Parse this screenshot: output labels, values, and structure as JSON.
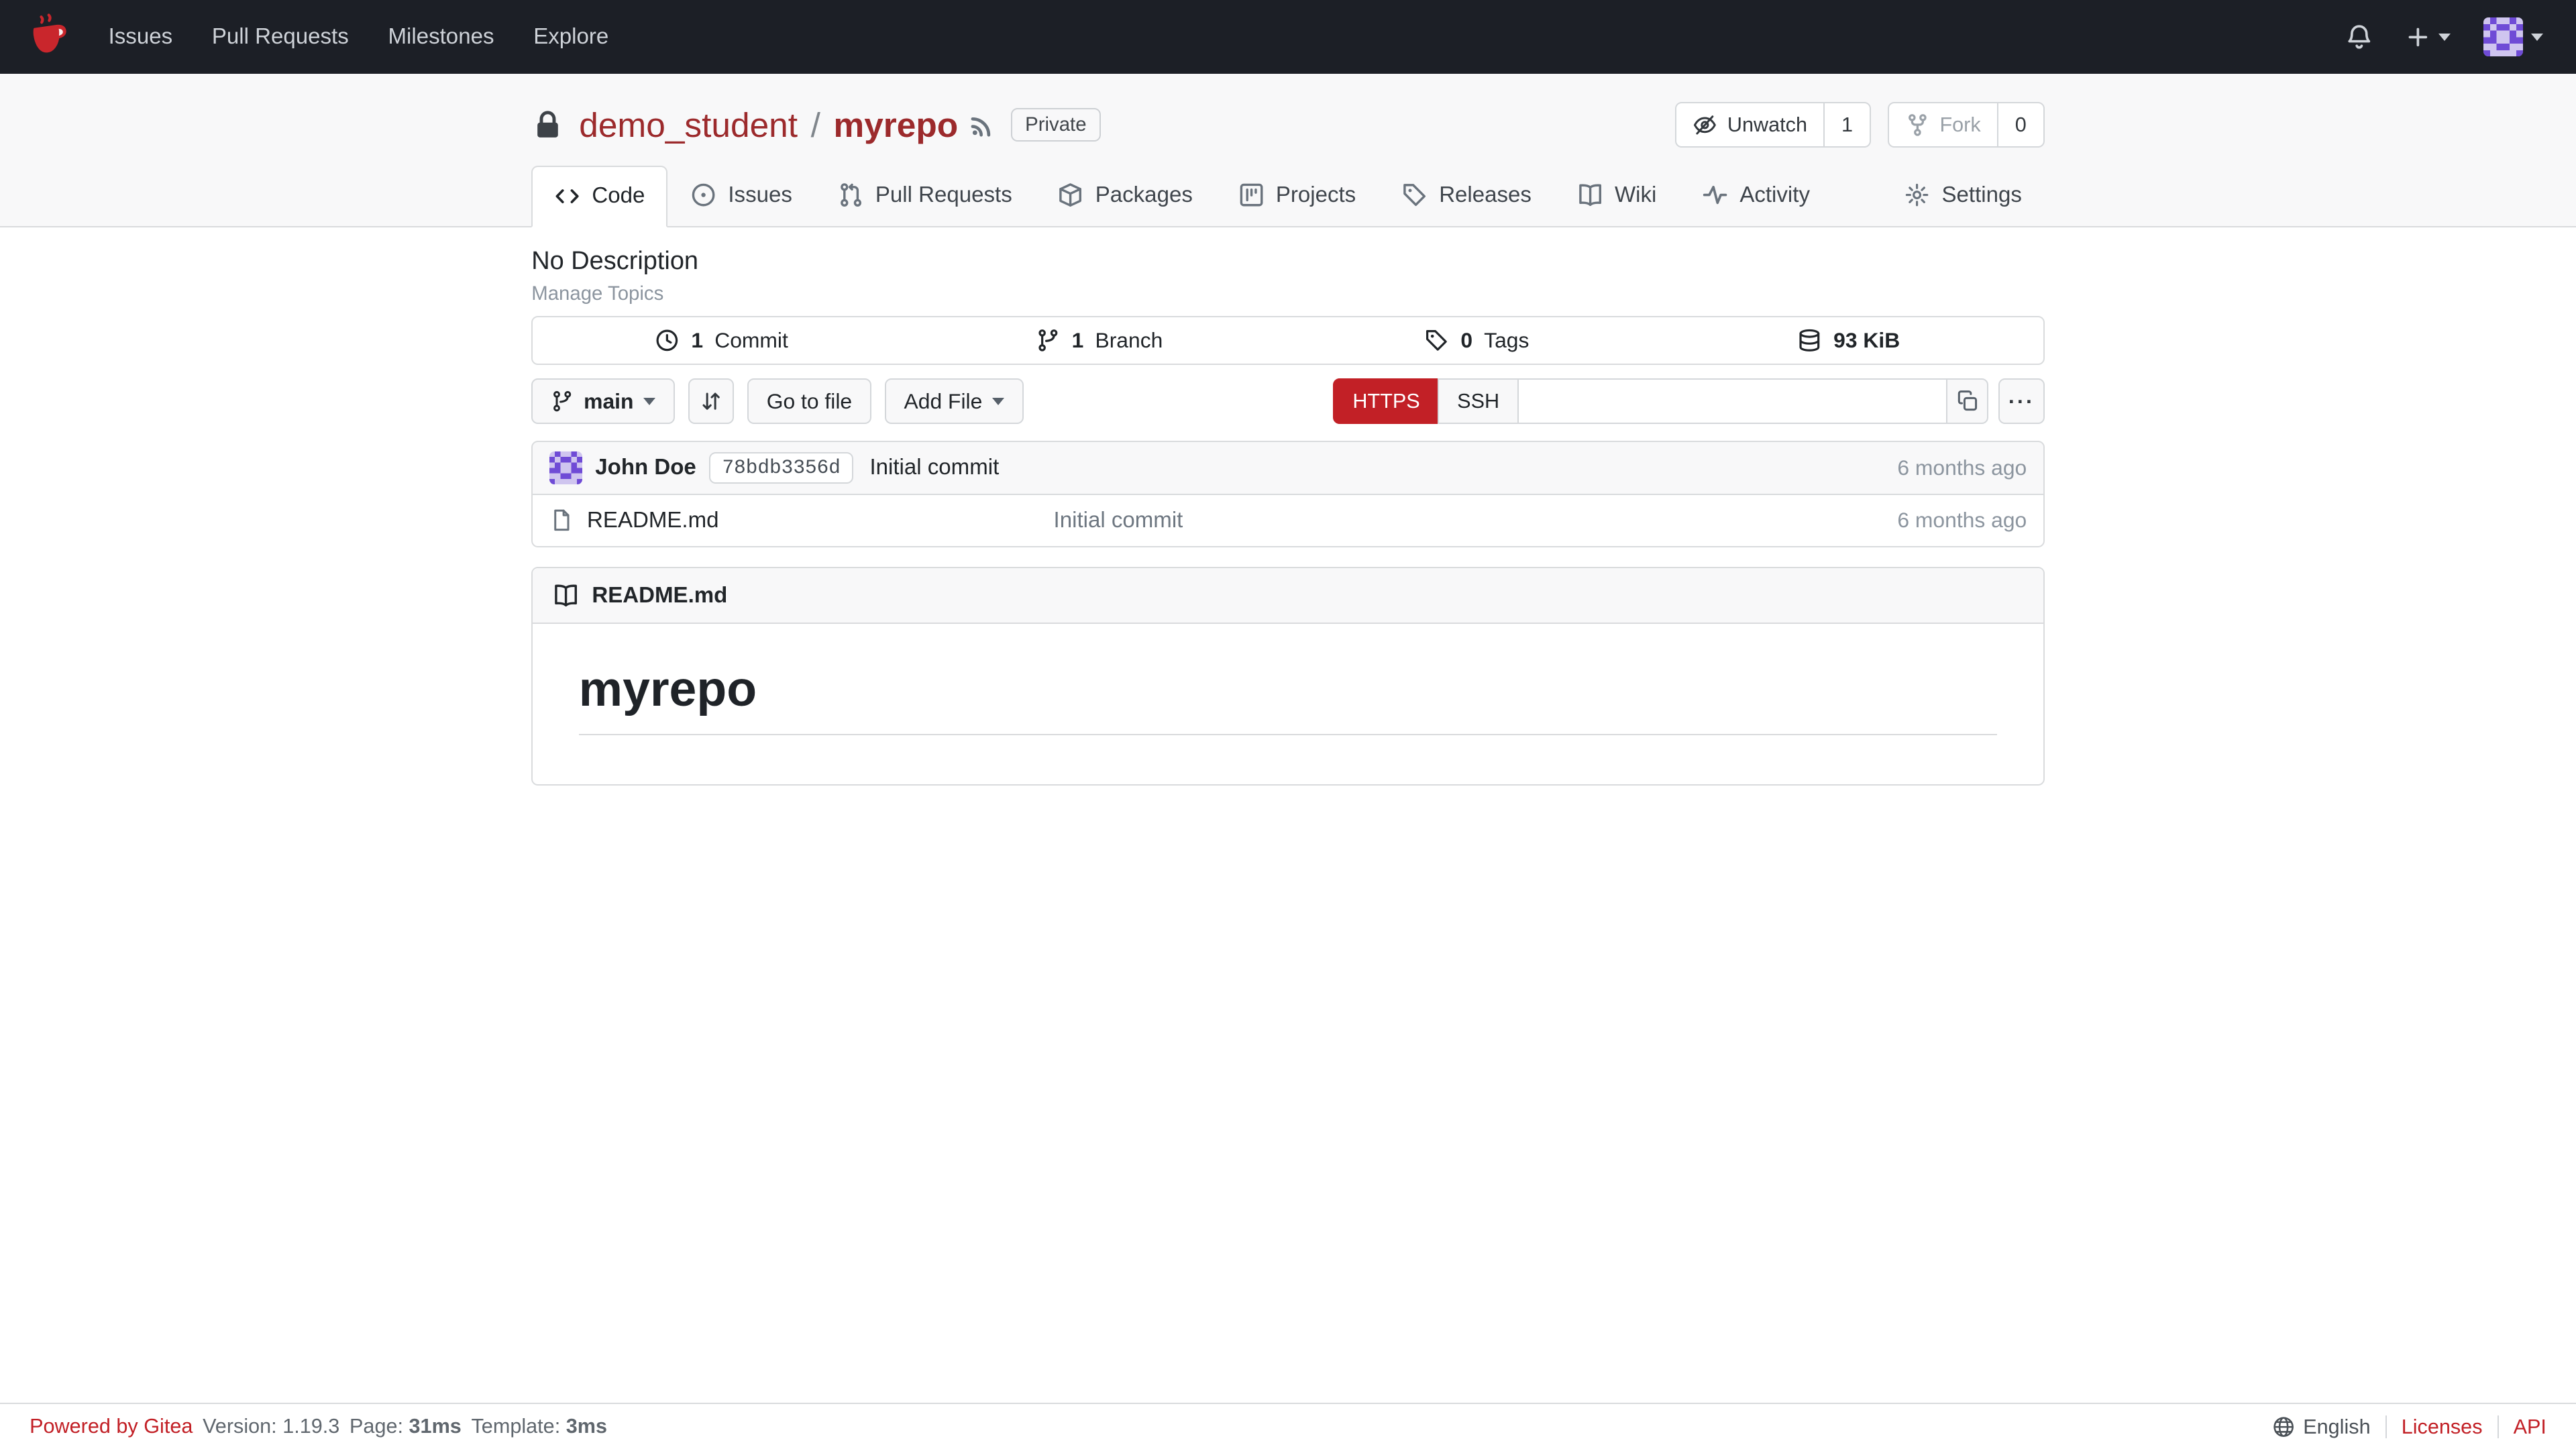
{
  "colors": {
    "accent": "#c22026",
    "link": "#9c2a2c",
    "navbar-bg": "#1c1f26",
    "border": "#d9dbdd",
    "box-bg": "#f8f8f9",
    "text": "#212529"
  },
  "navbar": {
    "links": [
      {
        "label": "Issues"
      },
      {
        "label": "Pull Requests"
      },
      {
        "label": "Milestones"
      },
      {
        "label": "Explore"
      }
    ]
  },
  "header": {
    "owner": "demo_student",
    "separator": "/",
    "repo": "myrepo",
    "visibility": "Private",
    "unwatch": {
      "label": "Unwatch",
      "count": "1"
    },
    "fork": {
      "label": "Fork",
      "count": "0"
    }
  },
  "tabs": {
    "code": "Code",
    "issues": "Issues",
    "pulls": "Pull Requests",
    "packages": "Packages",
    "projects": "Projects",
    "releases": "Releases",
    "wiki": "Wiki",
    "activity": "Activity",
    "settings": "Settings"
  },
  "overview": {
    "description": "No Description",
    "manage_topics": "Manage Topics",
    "stats": [
      {
        "value": "1",
        "label": "Commit"
      },
      {
        "value": "1",
        "label": "Branch"
      },
      {
        "value": "0",
        "label": "Tags"
      },
      {
        "value": "93 KiB",
        "label": ""
      }
    ]
  },
  "controls": {
    "branch": "main",
    "go_to_file": "Go to file",
    "add_file": "Add File",
    "https": "HTTPS",
    "ssh": "SSH",
    "clone_url": ""
  },
  "commit": {
    "author": "John Doe",
    "sha": "78bdb3356d",
    "message": "Initial commit",
    "age": "6 months ago"
  },
  "files": [
    {
      "name": "README.md",
      "message": "Initial commit",
      "age": "6 months ago"
    }
  ],
  "readme": {
    "filename": "README.md",
    "heading": "myrepo"
  },
  "footer": {
    "powered": "Powered by Gitea",
    "version_label": "Version:",
    "version": "1.19.3",
    "page_label": "Page:",
    "page_ms": "31ms",
    "template_label": "Template:",
    "template_ms": "3ms",
    "language": "English",
    "licenses": "Licenses",
    "api": "API"
  },
  "icons": {
    "gitea-logo": "red teacup",
    "bell": "notification bell",
    "plus": "+",
    "chevron": "dropdown caret",
    "lock": "padlock",
    "rss": "rss feed",
    "eye-slash": "unwatch eye",
    "fork": "git fork",
    "code": "angle brackets",
    "issue": "circled dot",
    "pull-request": "git pull request",
    "package": "box",
    "project": "kanban board",
    "tag": "tag",
    "book": "open book",
    "pulse": "activity pulse",
    "gear": "settings gear",
    "history": "clock",
    "branch": "git branch",
    "database": "database stack",
    "compare": "up down arrows",
    "copy": "copy",
    "ellipsis": "···",
    "file": "document",
    "globe": "globe"
  }
}
